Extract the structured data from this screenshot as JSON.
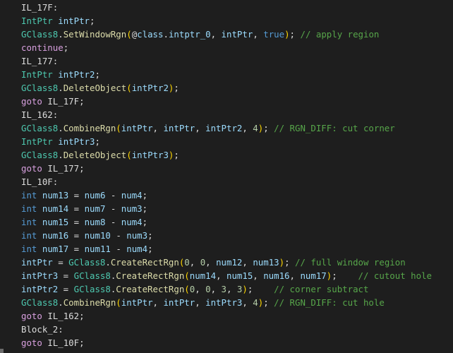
{
  "colors": {
    "background": "#1e1e1e",
    "label": "#dcdcdc",
    "type": "#4ec9b0",
    "keyword": "#569cd6",
    "control": "#d8a0df",
    "method": "#dcdcaa",
    "variable": "#9cdcfe",
    "number": "#b5cea8",
    "comment": "#57a64a",
    "paren": "#ffd700"
  },
  "code_lines": [
    [
      [
        "label",
        "IL_17F:"
      ]
    ],
    [
      [
        "type",
        "IntPtr"
      ],
      [
        "ws",
        " "
      ],
      [
        "var",
        "intPtr"
      ],
      [
        "punct",
        ";"
      ]
    ],
    [
      [
        "cls",
        "GClass8"
      ],
      [
        "punct",
        "."
      ],
      [
        "method",
        "SetWindowRgn"
      ],
      [
        "paren",
        "("
      ],
      [
        "punct",
        "@"
      ],
      [
        "var",
        "class"
      ],
      [
        "punct",
        "."
      ],
      [
        "var",
        "intptr_0"
      ],
      [
        "punct",
        ", "
      ],
      [
        "var",
        "intPtr"
      ],
      [
        "punct",
        ", "
      ],
      [
        "kw",
        "true"
      ],
      [
        "paren",
        ")"
      ],
      [
        "punct",
        ";"
      ],
      [
        "ws",
        " "
      ],
      [
        "comment",
        "// apply region"
      ]
    ],
    [
      [
        "ctrl",
        "continue"
      ],
      [
        "punct",
        ";"
      ]
    ],
    [
      [
        "label",
        "IL_177:"
      ]
    ],
    [
      [
        "type",
        "IntPtr"
      ],
      [
        "ws",
        " "
      ],
      [
        "var",
        "intPtr2"
      ],
      [
        "punct",
        ";"
      ]
    ],
    [
      [
        "cls",
        "GClass8"
      ],
      [
        "punct",
        "."
      ],
      [
        "method",
        "DeleteObject"
      ],
      [
        "paren",
        "("
      ],
      [
        "var",
        "intPtr2"
      ],
      [
        "paren",
        ")"
      ],
      [
        "punct",
        ";"
      ]
    ],
    [
      [
        "ctrl",
        "goto"
      ],
      [
        "ws",
        " "
      ],
      [
        "label",
        "IL_17F"
      ],
      [
        "punct",
        ";"
      ]
    ],
    [
      [
        "label",
        "IL_162:"
      ]
    ],
    [
      [
        "cls",
        "GClass8"
      ],
      [
        "punct",
        "."
      ],
      [
        "method",
        "CombineRgn"
      ],
      [
        "paren",
        "("
      ],
      [
        "var",
        "intPtr"
      ],
      [
        "punct",
        ", "
      ],
      [
        "var",
        "intPtr"
      ],
      [
        "punct",
        ", "
      ],
      [
        "var",
        "intPtr2"
      ],
      [
        "punct",
        ", "
      ],
      [
        "num",
        "4"
      ],
      [
        "paren",
        ")"
      ],
      [
        "punct",
        ";"
      ],
      [
        "ws",
        " "
      ],
      [
        "comment",
        "// RGN_DIFF: cut corner"
      ]
    ],
    [
      [
        "type",
        "IntPtr"
      ],
      [
        "ws",
        " "
      ],
      [
        "var",
        "intPtr3"
      ],
      [
        "punct",
        ";"
      ]
    ],
    [
      [
        "cls",
        "GClass8"
      ],
      [
        "punct",
        "."
      ],
      [
        "method",
        "DeleteObject"
      ],
      [
        "paren",
        "("
      ],
      [
        "var",
        "intPtr3"
      ],
      [
        "paren",
        ")"
      ],
      [
        "punct",
        ";"
      ]
    ],
    [
      [
        "ctrl",
        "goto"
      ],
      [
        "ws",
        " "
      ],
      [
        "label",
        "IL_177"
      ],
      [
        "punct",
        ";"
      ]
    ],
    [
      [
        "label",
        "IL_10F:"
      ]
    ],
    [
      [
        "kw",
        "int"
      ],
      [
        "ws",
        " "
      ],
      [
        "var",
        "num13"
      ],
      [
        "punct",
        " = "
      ],
      [
        "var",
        "num6"
      ],
      [
        "punct",
        " - "
      ],
      [
        "var",
        "num4"
      ],
      [
        "punct",
        ";"
      ]
    ],
    [
      [
        "kw",
        "int"
      ],
      [
        "ws",
        " "
      ],
      [
        "var",
        "num14"
      ],
      [
        "punct",
        " = "
      ],
      [
        "var",
        "num7"
      ],
      [
        "punct",
        " - "
      ],
      [
        "var",
        "num3"
      ],
      [
        "punct",
        ";"
      ]
    ],
    [
      [
        "kw",
        "int"
      ],
      [
        "ws",
        " "
      ],
      [
        "var",
        "num15"
      ],
      [
        "punct",
        " = "
      ],
      [
        "var",
        "num8"
      ],
      [
        "punct",
        " - "
      ],
      [
        "var",
        "num4"
      ],
      [
        "punct",
        ";"
      ]
    ],
    [
      [
        "kw",
        "int"
      ],
      [
        "ws",
        " "
      ],
      [
        "var",
        "num16"
      ],
      [
        "punct",
        " = "
      ],
      [
        "var",
        "num10"
      ],
      [
        "punct",
        " - "
      ],
      [
        "var",
        "num3"
      ],
      [
        "punct",
        ";"
      ]
    ],
    [
      [
        "kw",
        "int"
      ],
      [
        "ws",
        " "
      ],
      [
        "var",
        "num17"
      ],
      [
        "punct",
        " = "
      ],
      [
        "var",
        "num11"
      ],
      [
        "punct",
        " - "
      ],
      [
        "var",
        "num4"
      ],
      [
        "punct",
        ";"
      ]
    ],
    [
      [
        "var",
        "intPtr"
      ],
      [
        "punct",
        " = "
      ],
      [
        "cls",
        "GClass8"
      ],
      [
        "punct",
        "."
      ],
      [
        "method",
        "CreateRectRgn"
      ],
      [
        "paren",
        "("
      ],
      [
        "num",
        "0"
      ],
      [
        "punct",
        ", "
      ],
      [
        "num",
        "0"
      ],
      [
        "punct",
        ", "
      ],
      [
        "var",
        "num12"
      ],
      [
        "punct",
        ", "
      ],
      [
        "var",
        "num13"
      ],
      [
        "paren",
        ")"
      ],
      [
        "punct",
        ";"
      ],
      [
        "ws",
        " "
      ],
      [
        "comment",
        "// full window region"
      ]
    ],
    [
      [
        "var",
        "intPtr3"
      ],
      [
        "punct",
        " = "
      ],
      [
        "cls",
        "GClass8"
      ],
      [
        "punct",
        "."
      ],
      [
        "method",
        "CreateRectRgn"
      ],
      [
        "paren",
        "("
      ],
      [
        "var",
        "num14"
      ],
      [
        "punct",
        ", "
      ],
      [
        "var",
        "num15"
      ],
      [
        "punct",
        ", "
      ],
      [
        "var",
        "num16"
      ],
      [
        "punct",
        ", "
      ],
      [
        "var",
        "num17"
      ],
      [
        "paren",
        ")"
      ],
      [
        "punct",
        ";"
      ],
      [
        "ws",
        "    "
      ],
      [
        "comment",
        "// cutout hole"
      ]
    ],
    [
      [
        "var",
        "intPtr2"
      ],
      [
        "punct",
        " = "
      ],
      [
        "cls",
        "GClass8"
      ],
      [
        "punct",
        "."
      ],
      [
        "method",
        "CreateRectRgn"
      ],
      [
        "paren",
        "("
      ],
      [
        "num",
        "0"
      ],
      [
        "punct",
        ", "
      ],
      [
        "num",
        "0"
      ],
      [
        "punct",
        ", "
      ],
      [
        "num",
        "3"
      ],
      [
        "punct",
        ", "
      ],
      [
        "num",
        "3"
      ],
      [
        "paren",
        ")"
      ],
      [
        "punct",
        ";"
      ],
      [
        "ws",
        "    "
      ],
      [
        "comment",
        "// corner subtract"
      ]
    ],
    [
      [
        "cls",
        "GClass8"
      ],
      [
        "punct",
        "."
      ],
      [
        "method",
        "CombineRgn"
      ],
      [
        "paren",
        "("
      ],
      [
        "var",
        "intPtr"
      ],
      [
        "punct",
        ", "
      ],
      [
        "var",
        "intPtr"
      ],
      [
        "punct",
        ", "
      ],
      [
        "var",
        "intPtr3"
      ],
      [
        "punct",
        ", "
      ],
      [
        "num",
        "4"
      ],
      [
        "paren",
        ")"
      ],
      [
        "punct",
        ";"
      ],
      [
        "ws",
        " "
      ],
      [
        "comment",
        "// RGN_DIFF: cut hole"
      ]
    ],
    [
      [
        "ctrl",
        "goto"
      ],
      [
        "ws",
        " "
      ],
      [
        "label",
        "IL_162"
      ],
      [
        "punct",
        ";"
      ]
    ],
    [
      [
        "label",
        "Block_2:"
      ]
    ],
    [
      [
        "ctrl",
        "goto"
      ],
      [
        "ws",
        " "
      ],
      [
        "label",
        "IL_10F"
      ],
      [
        "punct",
        ";"
      ]
    ]
  ]
}
